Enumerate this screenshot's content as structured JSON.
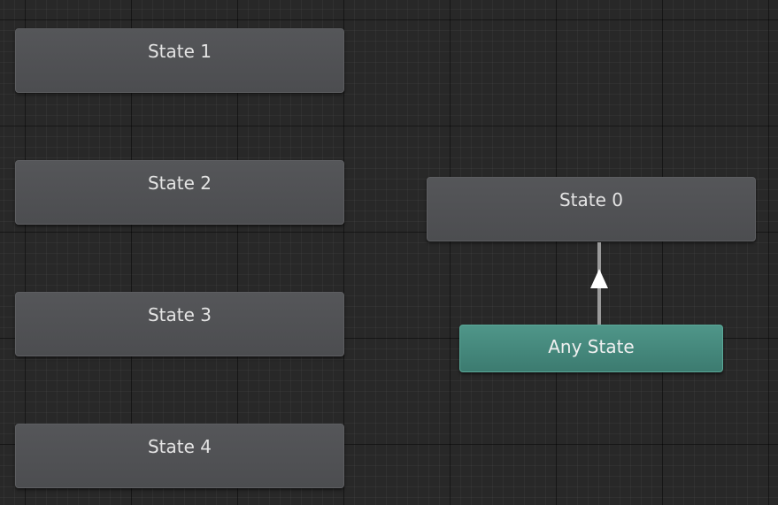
{
  "states": [
    {
      "id": "state-1",
      "label": "State 1"
    },
    {
      "id": "state-2",
      "label": "State 2"
    },
    {
      "id": "state-3",
      "label": "State 3"
    },
    {
      "id": "state-4",
      "label": "State 4"
    },
    {
      "id": "state-0",
      "label": "State 0"
    }
  ],
  "any_state": {
    "label": "Any State"
  },
  "transitions": [
    {
      "from": "Any State",
      "to": "State 0"
    }
  ],
  "colors": {
    "background": "#282828",
    "state_node": "#505154",
    "any_state_node": "#468a7e",
    "transition": "#9a9a9a",
    "arrow": "#ffffff",
    "text": "#e4e4e4"
  }
}
